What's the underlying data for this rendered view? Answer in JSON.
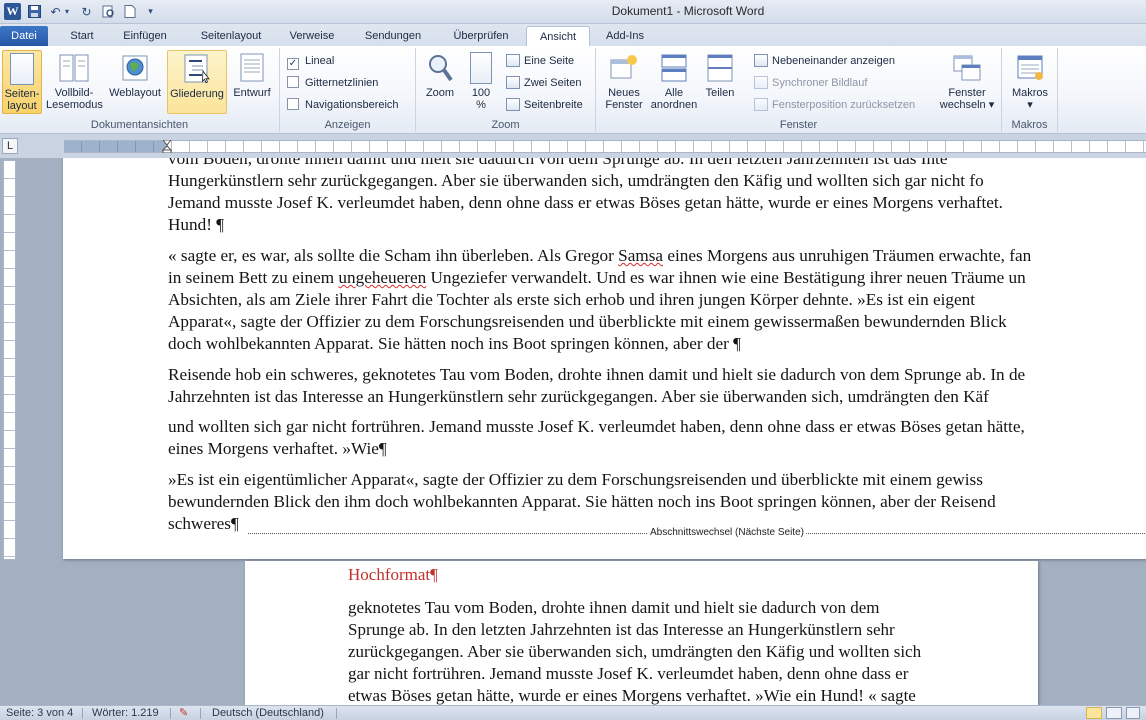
{
  "window": {
    "title": "Dokument1  -  Microsoft Word"
  },
  "quick_access": {
    "icons": [
      "word-app-icon",
      "save-icon",
      "undo-icon",
      "redo-icon",
      "print-preview-icon",
      "new-document-icon",
      "customize-icon"
    ]
  },
  "tabs": [
    "Datei",
    "Start",
    "Einfügen",
    "Seitenlayout",
    "Verweise",
    "Sendungen",
    "Überprüfen",
    "Ansicht",
    "Add-Ins"
  ],
  "active_tab": "Ansicht",
  "ribbon": {
    "dokumentansichten": {
      "label": "Dokumentansichten",
      "buttons": {
        "seitenlayout": [
          "Seiten-",
          "layout"
        ],
        "vollbild": [
          "Vollbild-",
          "Lesemodus"
        ],
        "weblayout": [
          "Weblayout"
        ],
        "gliederung": [
          "Gliederung"
        ],
        "entwurf": [
          "Entwurf"
        ]
      }
    },
    "anzeigen": {
      "label": "Anzeigen",
      "lineal": "Lineal",
      "lineal_checked": "✓",
      "gitternetzlinien": "Gitternetzlinien",
      "navigationsbereich": "Navigationsbereich"
    },
    "zoom": {
      "label": "Zoom",
      "zoom_btn": "Zoom",
      "hundred_top": "100",
      "hundred_bottom": "%",
      "eine_seite": "Eine Seite",
      "zwei_seiten": "Zwei Seiten",
      "seitenbreite": "Seitenbreite"
    },
    "fenster": {
      "label": "Fenster",
      "neues": [
        "Neues",
        "Fenster"
      ],
      "alle": [
        "Alle",
        "anordnen"
      ],
      "teilen": [
        "Teilen"
      ],
      "nebeneinander": "Nebeneinander anzeigen",
      "synchroner": "Synchroner Bildlauf",
      "fensterposition": "Fensterposition zurücksetzen",
      "wechseln": [
        "Fenster",
        "wechseln ▾"
      ]
    },
    "makros": {
      "label": "Makros",
      "button": [
        "Makros",
        "▾"
      ]
    }
  },
  "ruler": {
    "corner": "L"
  },
  "page1_lines": [
    "vom Boden, drohte ihnen damit und hielt sie dadurch von dem Sprunge ab. In den letzten Jahrzehnten ist das Inte",
    "Hungerkünstlern sehr zurückgegangen. Aber sie überwanden sich, umdrängten den Käfig und wollten sich gar nicht fo",
    "Jemand musste Josef K. verleumdet haben, denn ohne dass er etwas Böses getan hätte, wurde er eines Morgens verhaftet.",
    "Hund! ¶",
    "« sagte er, es war, als sollte die Scham ihn überleben. Als Gregor Samsa eines Morgens aus unruhigen Träumen erwachte, fan",
    "in seinem Bett zu einem ungeheueren Ungeziefer verwandelt. Und es war ihnen wie eine Bestätigung ihrer neuen Träume un",
    "Absichten, als am Ziele ihrer Fahrt die Tochter als erste sich erhob und ihren jungen Körper dehnte. »Es ist ein eigent",
    "Apparat«, sagte der Offizier zu dem Forschungsreisenden und überblickte mit einem gewissermaßen bewundernden Blick",
    "doch wohlbekannten Apparat. Sie hätten noch ins Boot springen können, aber der ¶",
    "Reisende hob ein schweres, geknotetes Tau vom Boden, drohte ihnen damit und hielt sie dadurch von dem Sprunge ab. In de",
    "Jahrzehnten ist das Interesse an Hungerkünstlern sehr zurückgegangen. Aber sie überwanden sich, umdrängten den Käf",
    "und wollten sich gar nicht fortrühren. Jemand musste Josef K. verleumdet haben, denn ohne dass er etwas Böses getan hätte,",
    "eines Morgens verhaftet. »Wie¶",
    "»Es ist ein eigentümlicher Apparat«, sagte der Offizier zu dem Forschungsreisenden und überblickte mit einem gewiss",
    "bewundernden Blick den ihm doch wohlbekannten Apparat. Sie hätten noch ins Boot springen können, aber der Reisend",
    "schweres¶"
  ],
  "section_break": "Abschnittswechsel (Nächste Seite)",
  "page2": {
    "heading": "Hochformat¶",
    "lines": [
      " geknotetes Tau vom Boden, drohte ihnen damit und hielt sie dadurch von dem",
      "Sprunge ab. In den letzten Jahrzehnten ist das Interesse an Hungerkünstlern sehr",
      "zurückgegangen. Aber sie überwanden sich, umdrängten den Käfig und wollten sich",
      "gar nicht fortrühren. Jemand musste Josef K. verleumdet haben, denn ohne dass er",
      "etwas Böses getan hätte, wurde er eines Morgens verhaftet. »Wie ein Hund! « sagte"
    ]
  },
  "status": {
    "seite": "Seite: 3 von 4",
    "woerter": "Wörter: 1.219",
    "sprache": "Deutsch (Deutschland)"
  },
  "colors": {
    "heading_red": "#c0312b",
    "tab_file_blue": "#2b5797",
    "active_button": "#f8d269"
  }
}
